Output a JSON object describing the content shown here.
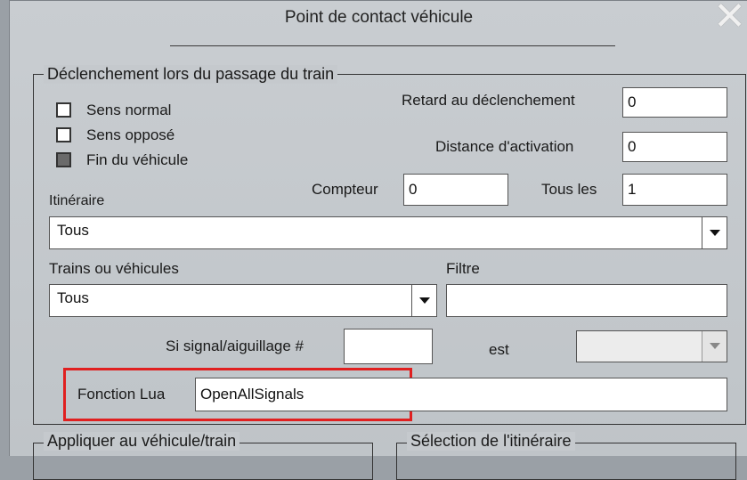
{
  "window": {
    "title": "Point de contact véhicule"
  },
  "trigger_group": {
    "title": "Déclenchement lors du passage du train",
    "sens_normal": {
      "label": "Sens normal",
      "checked": true
    },
    "sens_oppose": {
      "label": "Sens opposé",
      "checked": true
    },
    "fin_vehicule": {
      "label": "Fin du véhicule",
      "checked": false
    },
    "retard_label": "Retard au déclenchement",
    "retard_value": "0",
    "distance_label": "Distance d'activation",
    "distance_value": "0",
    "compteur_label": "Compteur",
    "compteur_value": "0",
    "tous_les_label": "Tous les",
    "tous_les_value": "1",
    "itineraire_label": "Itinéraire",
    "itineraire_value": "Tous",
    "trains_label": "Trains ou véhicules",
    "trains_value": "Tous",
    "filtre_label": "Filtre",
    "filtre_value": "",
    "signal_label": "Si signal/aiguillage #",
    "signal_value": "",
    "est_label": "est",
    "est_value": "",
    "lua_label": "Fonction Lua",
    "lua_value": "OpenAllSignals"
  },
  "bottom": {
    "appliquer_title": "Appliquer au véhicule/train",
    "selection_title": "Sélection de l'itinéraire"
  }
}
